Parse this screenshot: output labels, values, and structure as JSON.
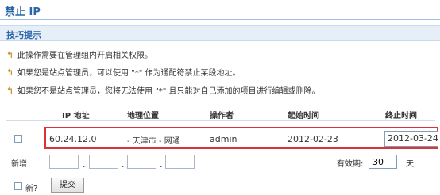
{
  "page": {
    "title": "禁止 IP"
  },
  "tips": {
    "heading": "技巧提示",
    "items": [
      "此操作需要在管理组内开启相关权限。",
      "如果您是站点管理员，可以使用 \"*\" 作为通配符禁止某段地址。",
      "如果您不是站点管理员，您将无法使用 \"*\" 且只能对自己添加的项目进行编辑或删除。"
    ]
  },
  "table": {
    "headers": [
      "IP 地址",
      "地理位置",
      "操作者",
      "起始时间",
      "终止时间"
    ],
    "rows": [
      {
        "ip": "60.24.12.0",
        "location": "- 天津市 - 网通",
        "operator": "admin",
        "start": "2012-02-23",
        "end": "2012-03-24"
      }
    ]
  },
  "add": {
    "label": "新增",
    "ip_separator": ".",
    "expiry_label": "有效期:",
    "expiry_value": "30",
    "expiry_unit": "天"
  },
  "footer": {
    "new_checkbox_label": "新?",
    "submit_label": "提交"
  },
  "colors": {
    "accent": "#2a66a8",
    "highlight_border": "#d9343a",
    "tips_bg": "#e6eef8"
  }
}
